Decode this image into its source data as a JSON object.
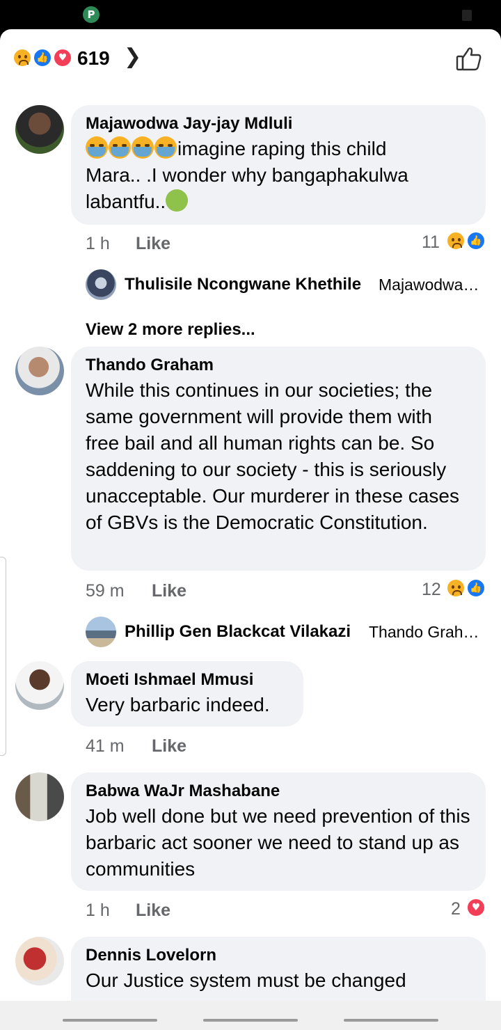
{
  "header": {
    "reaction_total": "619",
    "reaction_icons": [
      "sad-icon",
      "like-icon",
      "love-icon"
    ],
    "chevron_icon": "chevron-right-icon",
    "like_button_icon": "thumbs-up-outline-icon"
  },
  "colors": {
    "background": "#ffffff",
    "bubble": "#f0f2f5",
    "meta": "#65676b",
    "like_blue": "#1877f2",
    "love_red": "#f33e58",
    "sad_yellow": "#f7b125"
  },
  "comments": [
    {
      "author": "Majawodwa Jay-jay Mdluli",
      "text_line1": "imagine raping this child",
      "text_line2": "Mara.. .I wonder why bangaphakulwa",
      "text_line3": "labantfu..",
      "emoji_prefix": [
        "crying-face-icon",
        "crying-face-icon",
        "crying-face-icon",
        "crying-face-icon"
      ],
      "emoji_suffix": "nauseated-face-icon",
      "time": "1 h",
      "like_label": "Like",
      "reaction_count": "11",
      "reactions": [
        "sad-icon",
        "like-icon"
      ],
      "reply_preview": {
        "name": "Thulisile Ncongwane Khethile",
        "snippet": "Majawodwa…"
      },
      "more_replies": "View 2 more replies..."
    },
    {
      "author": "Thando Graham",
      "text": "While this continues in our societies; the same government will provide them with free bail and all human rights can be. So saddening to our society - this is seriously unacceptable. Our murderer in these cases of GBVs is the Democratic Constitution.",
      "time": "59 m",
      "like_label": "Like",
      "reaction_count": "12",
      "reactions": [
        "sad-icon",
        "like-icon"
      ],
      "reply_preview": {
        "name": "Phillip Gen Blackcat Vilakazi",
        "snippet": "Thando Grah…"
      }
    },
    {
      "author": "Moeti Ishmael Mmusi",
      "text": "Very barbaric indeed.",
      "time": "41 m",
      "like_label": "Like"
    },
    {
      "author": "Babwa WaJr Mashabane",
      "text": "Job well done but we need prevention of this barbaric act sooner we need to stand up as communities",
      "time": "1 h",
      "like_label": "Like",
      "reaction_count": "2",
      "reactions": [
        "love-icon"
      ]
    },
    {
      "author": "Dennis Lovelorn",
      "text": "Our Justice system must be changed"
    }
  ]
}
